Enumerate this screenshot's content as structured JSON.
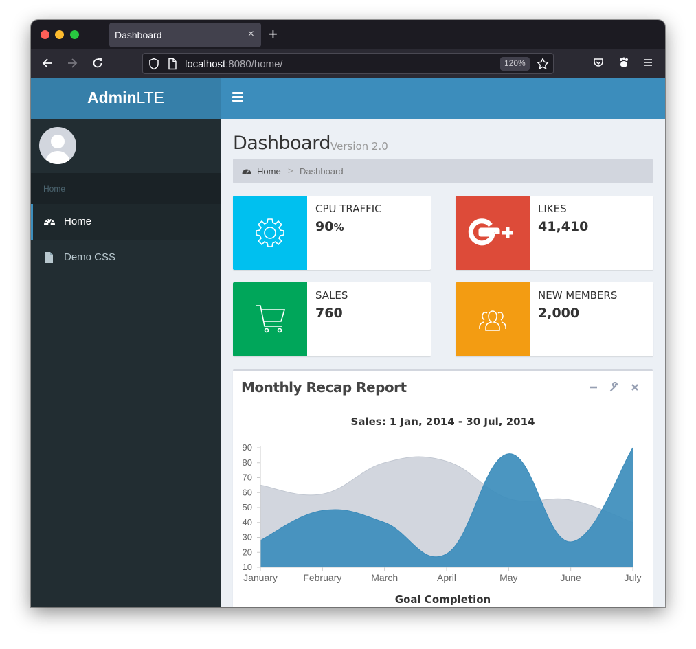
{
  "browser": {
    "tab_title": "Dashboard",
    "tab_close": "×",
    "new_tab": "+",
    "url_host": "localhost",
    "url_rest": ":8080/home/",
    "zoom": "120%"
  },
  "app": {
    "logo_bold": "Admin",
    "logo_light": "LTE"
  },
  "sidebar": {
    "header": "Home",
    "items": [
      {
        "label": "Home",
        "icon": "dashboard-icon",
        "active": true
      },
      {
        "label": "Demo CSS",
        "icon": "file-icon",
        "active": false
      }
    ]
  },
  "page": {
    "title": "Dashboard",
    "subtitle": "Version 2.0",
    "breadcrumb": {
      "home": "Home",
      "separator": ">",
      "current": "Dashboard"
    }
  },
  "info_boxes": [
    {
      "label": "CPU TRAFFIC",
      "number": "90",
      "unit": "%",
      "icon": "gear-icon",
      "color": "#00c0ef"
    },
    {
      "label": "LIKES",
      "number": "41,410",
      "unit": "",
      "icon": "google-plus-icon",
      "color": "#dd4b39"
    },
    {
      "label": "SALES",
      "number": "760",
      "unit": "",
      "icon": "shopping-cart-icon",
      "color": "#00a65a"
    },
    {
      "label": "NEW MEMBERS",
      "number": "2,000",
      "unit": "",
      "icon": "users-icon",
      "color": "#f39c12"
    }
  ],
  "report": {
    "title": "Monthly Recap Report",
    "tools": [
      "minus-icon",
      "wrench-icon",
      "close-icon"
    ],
    "goal_title": "Goal Completion"
  },
  "chart_data": {
    "type": "area",
    "title": "Sales: 1 Jan, 2014 - 30 Jul, 2014",
    "categories": [
      "January",
      "February",
      "March",
      "April",
      "May",
      "June",
      "July"
    ],
    "y_ticks": [
      10,
      20,
      30,
      40,
      50,
      60,
      70,
      80,
      90
    ],
    "ylim": [
      10,
      90
    ],
    "series": [
      {
        "values": [
          65,
          59,
          80,
          81,
          56,
          55,
          40
        ],
        "color": "#d2d6de"
      },
      {
        "values": [
          28,
          48,
          40,
          19,
          86,
          27,
          90
        ],
        "color": "#3c8dbc"
      }
    ],
    "grid": false
  }
}
